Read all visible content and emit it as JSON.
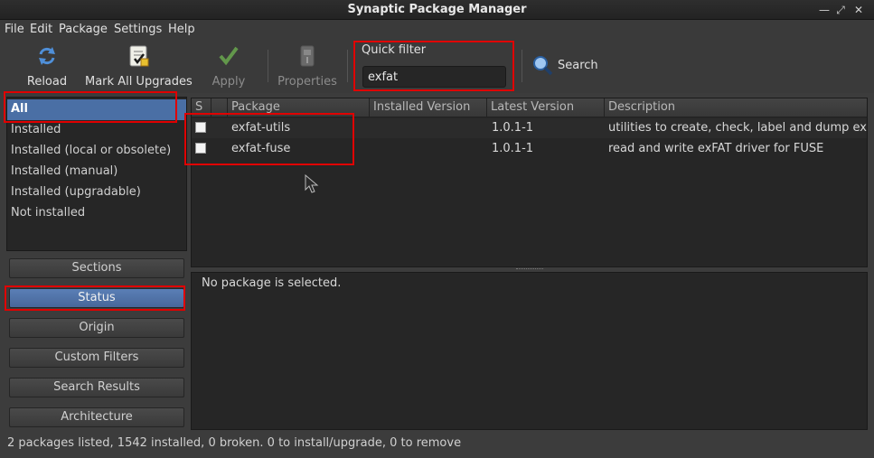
{
  "window": {
    "title": "Synaptic Package Manager"
  },
  "menu": [
    "File",
    "Edit",
    "Package",
    "Settings",
    "Help"
  ],
  "toolbar": {
    "reload": "Reload",
    "mark_all_upgrades": "Mark All Upgrades",
    "apply": "Apply",
    "properties": "Properties",
    "quick_filter_label": "Quick filter",
    "quick_filter_value": "exfat",
    "search": "Search"
  },
  "filters": [
    "All",
    "Installed",
    "Installed (local or obsolete)",
    "Installed (manual)",
    "Installed (upgradable)",
    "Not installed"
  ],
  "selected_filter": "All",
  "side_buttons": [
    "Sections",
    "Status",
    "Origin",
    "Custom Filters",
    "Search Results",
    "Architecture"
  ],
  "active_side_button": "Status",
  "table": {
    "headers": [
      "S",
      "Package",
      "Installed Version",
      "Latest Version",
      "Description"
    ],
    "rows": [
      {
        "package": "exfat-utils",
        "installed": "",
        "latest": "1.0.1-1",
        "description": "utilities to create, check, label and dump exFAT"
      },
      {
        "package": "exfat-fuse",
        "installed": "",
        "latest": "1.0.1-1",
        "description": "read and write exFAT driver for FUSE"
      }
    ]
  },
  "details": {
    "text": "No package is selected."
  },
  "status": {
    "text": "2 packages listed, 1542 installed, 0 broken. 0 to install/upgrade, 0 to remove"
  },
  "colors": {
    "highlight": "#e00000",
    "selection": "#4a6fa5"
  }
}
